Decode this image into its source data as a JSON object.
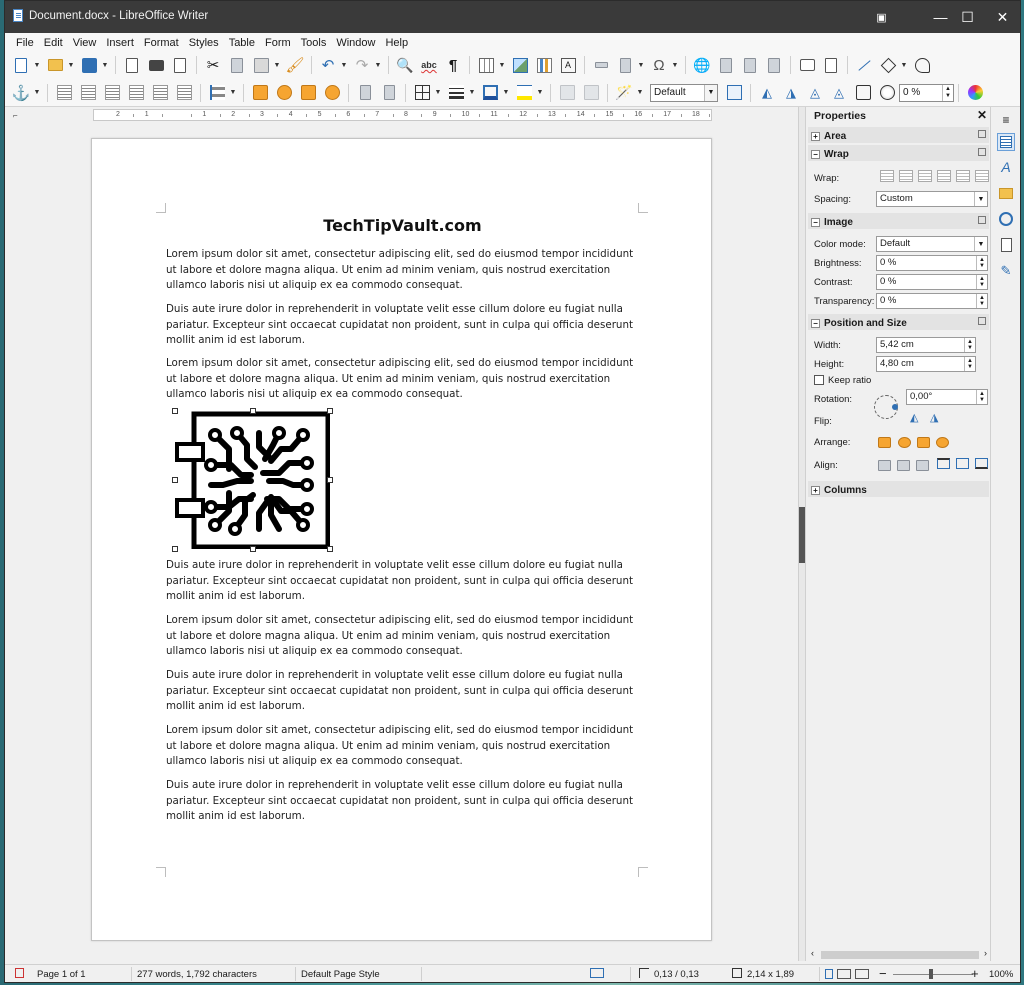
{
  "window": {
    "title": "Document.docx - LibreOffice Writer",
    "minimize": "—",
    "maximize": "☐",
    "close": "✕"
  },
  "menu": [
    "File",
    "Edit",
    "View",
    "Insert",
    "Format",
    "Styles",
    "Table",
    "Form",
    "Tools",
    "Window",
    "Help"
  ],
  "toolbar": {
    "frame_style": "Default",
    "transparency": "0 %"
  },
  "ruler": {
    "corner": "⌐",
    "marks": [
      "2",
      "1",
      "",
      "1",
      "2",
      "3",
      "4",
      "5",
      "6",
      "7",
      "8",
      "9",
      "10",
      "11",
      "12",
      "13",
      "14",
      "15",
      "16",
      "17",
      "18"
    ]
  },
  "document": {
    "title": "TechTipVault.com",
    "paragraphs": [
      "Lorem ipsum dolor sit amet, consectetur adipiscing elit, sed do eiusmod tempor incididunt ut labore et dolore magna aliqua. Ut enim ad minim veniam, quis nostrud exercitation ullamco laboris nisi ut aliquip ex ea commodo consequat.",
      "Duis aute irure dolor in reprehenderit in voluptate velit esse cillum dolore eu fugiat nulla pariatur. Excepteur sint occaecat cupidatat non proident, sunt in culpa qui officia deserunt mollit anim id est laborum.",
      "Lorem ipsum dolor sit amet, consectetur adipiscing elit, sed do eiusmod tempor incididunt ut labore et dolore magna aliqua. Ut enim ad minim veniam, quis nostrud exercitation ullamco laboris nisi ut aliquip ex ea commodo consequat.",
      "Duis aute irure dolor in reprehenderit in voluptate velit esse cillum dolore eu fugiat nulla pariatur. Excepteur sint occaecat cupidatat non proident, sunt in culpa qui officia deserunt mollit anim id est laborum.",
      "Lorem ipsum dolor sit amet, consectetur adipiscing elit, sed do eiusmod tempor incididunt ut labore et dolore magna aliqua. Ut enim ad minim veniam, quis nostrud exercitation ullamco laboris nisi ut aliquip ex ea commodo consequat.",
      "Duis aute irure dolor in reprehenderit in voluptate velit esse cillum dolore eu fugiat nulla pariatur. Excepteur sint occaecat cupidatat non proident, sunt in culpa qui officia deserunt mollit anim id est laborum.",
      "Lorem ipsum dolor sit amet, consectetur adipiscing elit, sed do eiusmod tempor incididunt ut labore et dolore magna aliqua. Ut enim ad minim veniam, quis nostrud exercitation ullamco laboris nisi ut aliquip ex ea commodo consequat.",
      "Duis aute irure dolor in reprehenderit in voluptate velit esse cillum dolore eu fugiat nulla pariatur. Excepteur sint occaecat cupidatat non proident, sunt in culpa qui officia deserunt mollit anim id est laborum."
    ]
  },
  "sidebar": {
    "title": "Properties",
    "close": "✕",
    "sections": {
      "area": "Area",
      "wrap": "Wrap",
      "image": "Image",
      "position": "Position and Size",
      "columns": "Columns"
    },
    "wrap_label": "Wrap:",
    "spacing_label": "Spacing:",
    "spacing_value": "Custom",
    "color_mode_label": "Color mode:",
    "color_mode_value": "Default",
    "brightness_label": "Brightness:",
    "brightness_value": "0 %",
    "contrast_label": "Contrast:",
    "contrast_value": "0 %",
    "transparency_label": "Transparency:",
    "transparency_value": "0 %",
    "width_label": "Width:",
    "width_value": "5,42 cm",
    "height_label": "Height:",
    "height_value": "4,80 cm",
    "keep_ratio_label": "Keep ratio",
    "rotation_label": "Rotation:",
    "rotation_value": "0,00°",
    "flip_label": "Flip:",
    "arrange_label": "Arrange:",
    "align_label": "Align:",
    "plus": "+",
    "minus": "−"
  },
  "status": {
    "page": "Page 1 of 1",
    "words": "277 words, 1,792 characters",
    "page_style": "Default Page Style",
    "position": "0,13 / 0,13",
    "size": "2,14 x 1,89",
    "zoom": "100%",
    "zoom_minus": "−",
    "zoom_plus": "+"
  },
  "colors": {
    "accent": "#2f6fb3",
    "title_bar": "#3a3a3a",
    "selection_handle": "#333333"
  },
  "icons": [
    "new-doc-icon",
    "open-folder-icon",
    "save-icon",
    "export-pdf-icon",
    "print-icon",
    "print-preview-icon",
    "cut-icon",
    "copy-icon",
    "paste-icon",
    "clone-formatting-icon",
    "undo-icon",
    "redo-icon",
    "find-replace-icon",
    "spelling-icon",
    "formatting-marks-icon",
    "table-icon",
    "image-icon",
    "chart-icon",
    "textbox-icon",
    "page-break-icon",
    "field-icon",
    "special-char-icon",
    "hyperlink-icon",
    "footnote-icon",
    "comment-icon",
    "track-changes-icon",
    "line-icon",
    "shapes-icon",
    "anchor-icon",
    "wrap-icon",
    "align-icon",
    "arrange-icon",
    "border-icon",
    "line-style-icon",
    "border-color-icon",
    "area-color-icon",
    "properties-deck-icon",
    "styles-deck-icon",
    "gallery-deck-icon",
    "navigator-deck-icon",
    "page-deck-icon",
    "style-inspector-deck-icon"
  ]
}
